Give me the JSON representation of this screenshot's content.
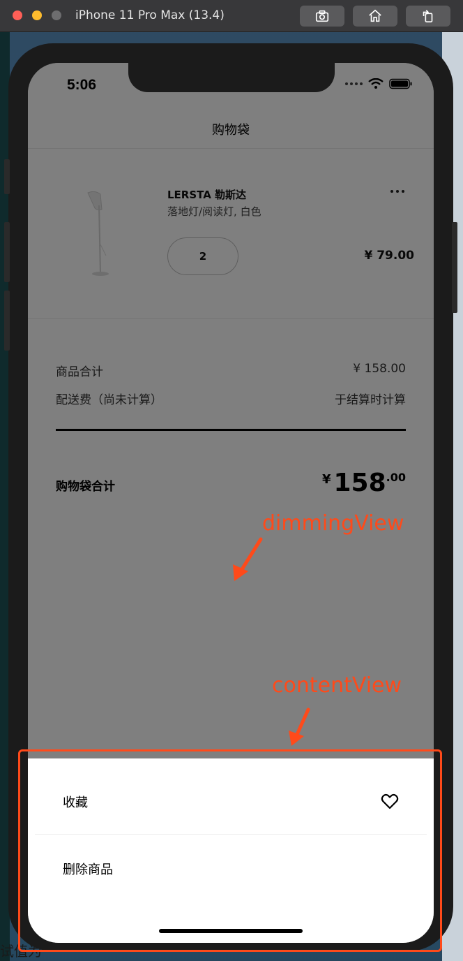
{
  "window": {
    "title": "iPhone 11 Pro Max (13.4)"
  },
  "toolbar": {
    "screenshot_icon": "camera-icon",
    "home_icon": "home-icon",
    "rotate_icon": "rotate-icon"
  },
  "desktop": {
    "bottom_fragment": "试值为"
  },
  "status_bar": {
    "time": "5:06"
  },
  "header": {
    "title": "购物袋"
  },
  "product": {
    "name": "LERSTA 勒斯达",
    "description": "落地灯/阅读灯, 白色",
    "quantity": "2",
    "price": "¥ 79.00"
  },
  "summary": {
    "subtotal_label": "商品合计",
    "subtotal_value": "¥ 158.00",
    "shipping_label": "配送费（尚未计算）",
    "shipping_value": "于结算时计算",
    "total_label": "购物袋合计",
    "total_currency": "¥",
    "total_integer": "158",
    "total_decimal": ".00"
  },
  "sheet": {
    "favorite_label": "收藏",
    "favorite_icon": "heart-icon",
    "delete_label": "删除商品"
  },
  "annotations": {
    "dimming_label": "dimmingView",
    "content_label": "contentView"
  },
  "colors": {
    "annotation": "#ff4a1a",
    "dim_overlay": "rgba(0,0,0,0.5)"
  }
}
